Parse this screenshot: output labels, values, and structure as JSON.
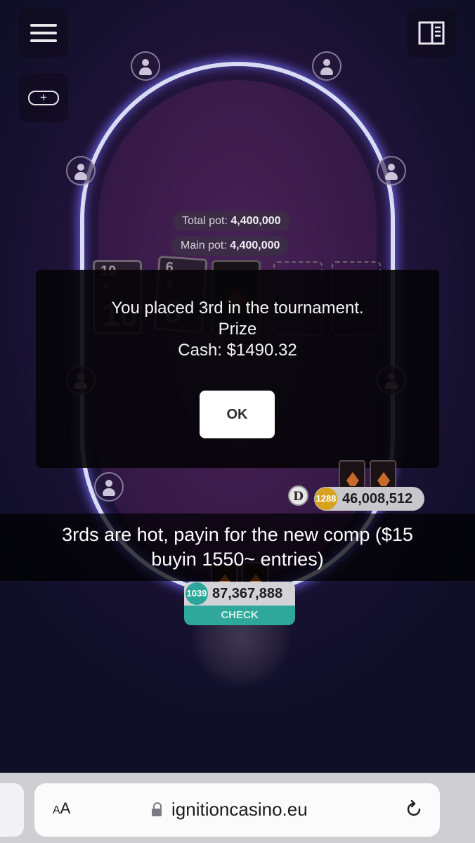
{
  "table": {
    "total_pot_label": "Total pot:",
    "total_pot_value": "4,400,000",
    "main_pot_label": "Main pot:",
    "main_pot_value": "4,400,000",
    "board": [
      {
        "rank": "10",
        "suit": "♠",
        "state": "face"
      },
      {
        "rank": "6",
        "suit": "♠",
        "state": "face"
      },
      {
        "state": "back"
      },
      {
        "state": "empty"
      },
      {
        "state": "empty"
      }
    ],
    "opponent": {
      "chip_badge": "1288",
      "stack": "46,008,512",
      "dealer_label": "D"
    },
    "hero": {
      "chip_badge": "1039",
      "stack": "87,367,888",
      "action_label": "CHECK"
    }
  },
  "dialog": {
    "line1": "You placed 3rd in the tournament.",
    "line2": "Prize",
    "line3": "Cash: $1490.32",
    "ok_label": "OK"
  },
  "caption": {
    "line1": "3rds are hot, payin for the new comp ($15",
    "line2": "buyin 1550~ entries)"
  },
  "browser": {
    "aa_large": "A",
    "aa_small": "A",
    "url": "ignitioncasino.eu"
  },
  "icons": {
    "menu": "hamburger-icon",
    "add_table": "add-table-icon",
    "layout": "sidebar-layout-icon",
    "lock": "lock-icon",
    "reload": "reload-icon"
  },
  "colors": {
    "rail_glow": "#7a6eff",
    "felt": "#3a1b4a",
    "check_button": "#2fa79b",
    "chip_gold": "#d7a21e"
  }
}
